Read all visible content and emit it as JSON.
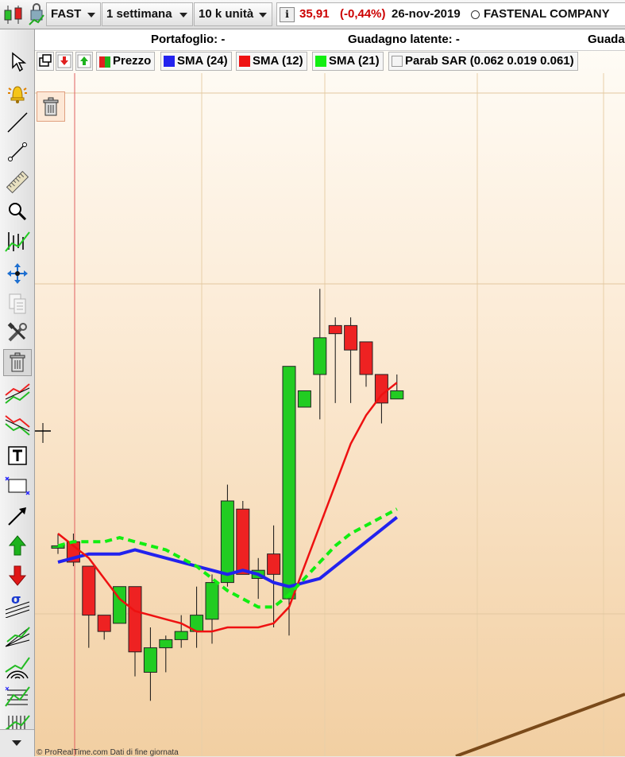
{
  "toolbar": {
    "symbol": "FAST",
    "period": "1 settimana",
    "units": "10 k unità",
    "price": "35,91",
    "change": "(-0,44%)",
    "date": "26-nov-2019",
    "company": "FASTENAL COMPANY",
    "price_color": "#cc0000"
  },
  "portfolio_bar": {
    "portafoglio": "Portafoglio: -",
    "guadagno": "Guadagno latente: -",
    "guada_cut": "Guada"
  },
  "legend": {
    "price": "Prezzo",
    "sma24": "SMA (24)",
    "sma12": "SMA (12)",
    "sma21": "SMA (21)",
    "sar": "Parab SAR (0.062 0.019 0.061)"
  },
  "colors": {
    "up": "#22cc22",
    "down": "#ee2222",
    "sma24": "#2222ee",
    "sma12": "#ee1111",
    "sma21": "#11ee11",
    "trend": "#7a4a1a"
  },
  "sidebar_tools": [
    "pointer-icon",
    "alert-bell-icon",
    "line-icon",
    "segment-icon",
    "ruler-icon",
    "zoom-icon",
    "indicator-icon",
    "move-icon",
    "copy-icon",
    "tools-icon",
    "trash-icon",
    "channel-up-icon",
    "channel-down-icon",
    "text-icon",
    "horizontal-line-icon",
    "arrow-icon",
    "up-arrow-icon",
    "down-arrow-icon",
    "sigma-icon",
    "fan-icon",
    "arc-icon",
    "fibonacci-icon",
    "cycles-icon"
  ],
  "footer": "© ProRealTime.com  Dati di fine giornata",
  "chart_data": {
    "type": "candlestick",
    "candles": [
      {
        "o": 34.3,
        "h": 34.6,
        "l": 34.1,
        "c": 34.3
      },
      {
        "o": 34.4,
        "h": 34.6,
        "l": 33.8,
        "c": 33.9
      },
      {
        "o": 33.8,
        "h": 33.8,
        "l": 31.8,
        "c": 32.6
      },
      {
        "o": 32.6,
        "h": 32.6,
        "l": 32.0,
        "c": 32.2
      },
      {
        "o": 32.4,
        "h": 33.3,
        "l": 32.4,
        "c": 33.3
      },
      {
        "o": 33.3,
        "h": 33.3,
        "l": 31.1,
        "c": 31.7
      },
      {
        "o": 31.2,
        "h": 32.3,
        "l": 30.5,
        "c": 31.8
      },
      {
        "o": 31.8,
        "h": 32.1,
        "l": 31.2,
        "c": 32.0
      },
      {
        "o": 32.0,
        "h": 32.6,
        "l": 31.8,
        "c": 32.2
      },
      {
        "o": 32.2,
        "h": 33.3,
        "l": 31.8,
        "c": 32.6
      },
      {
        "o": 32.5,
        "h": 33.6,
        "l": 31.9,
        "c": 33.4
      },
      {
        "o": 33.4,
        "h": 35.8,
        "l": 33.3,
        "c": 35.4
      },
      {
        "o": 35.2,
        "h": 35.4,
        "l": 34.2,
        "c": 33.6
      },
      {
        "o": 33.5,
        "h": 34.0,
        "l": 33.0,
        "c": 33.7
      },
      {
        "o": 34.1,
        "h": 34.8,
        "l": 32.3,
        "c": 33.6
      },
      {
        "o": 33.0,
        "h": 38.7,
        "l": 32.1,
        "c": 38.7
      },
      {
        "o": 37.7,
        "h": 38.1,
        "l": 37.7,
        "c": 38.1
      },
      {
        "o": 38.5,
        "h": 40.6,
        "l": 37.4,
        "c": 39.4
      },
      {
        "o": 39.7,
        "h": 39.9,
        "l": 37.8,
        "c": 39.5
      },
      {
        "o": 39.7,
        "h": 39.9,
        "l": 37.8,
        "c": 39.1
      },
      {
        "o": 39.3,
        "h": 39.3,
        "l": 38.2,
        "c": 38.5
      },
      {
        "o": 38.5,
        "h": 38.5,
        "l": 37.3,
        "c": 37.8
      },
      {
        "o": 37.9,
        "h": 38.5,
        "l": 37.9,
        "c": 38.1
      }
    ],
    "sma24": [
      33.9,
      34.0,
      34.1,
      34.1,
      34.1,
      34.2,
      34.1,
      34.0,
      33.9,
      33.8,
      33.7,
      33.6,
      33.7,
      33.6,
      33.4,
      33.3,
      33.4,
      33.5,
      33.8,
      34.1,
      34.4,
      34.7,
      35.0
    ],
    "sma12": [
      34.6,
      34.3,
      34.0,
      33.5,
      33.0,
      32.7,
      32.6,
      32.5,
      32.4,
      32.2,
      32.2,
      32.3,
      32.3,
      32.3,
      32.4,
      32.8,
      33.8,
      34.8,
      35.8,
      36.8,
      37.5,
      38.0,
      38.3
    ],
    "sma21": [
      34.3,
      34.4,
      34.4,
      34.4,
      34.5,
      34.4,
      34.3,
      34.2,
      34.0,
      33.8,
      33.5,
      33.2,
      33.0,
      32.8,
      32.8,
      33.1,
      33.5,
      33.9,
      34.3,
      34.6,
      34.8,
      35.0,
      35.2
    ]
  }
}
